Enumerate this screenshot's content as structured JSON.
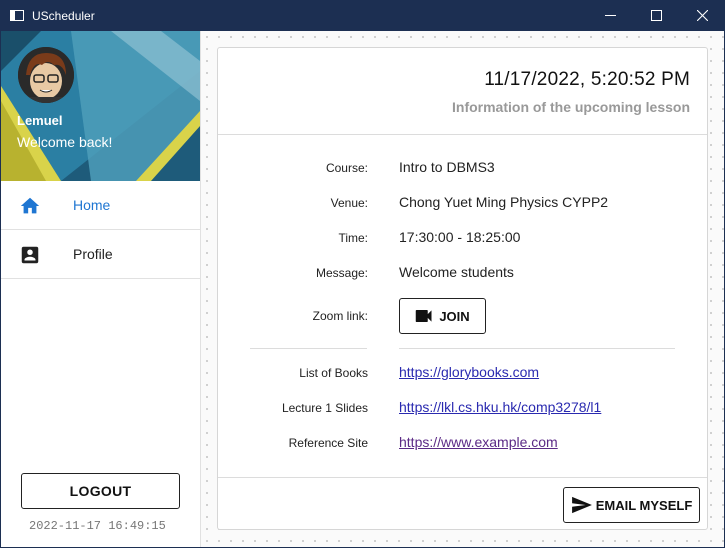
{
  "window": {
    "title": "UScheduler",
    "controls": [
      "minimize-icon",
      "maximize-icon",
      "close-icon"
    ]
  },
  "sidebar": {
    "user_name": "Lemuel",
    "welcome": "Welcome back!",
    "nav": [
      {
        "label": "Home",
        "icon": "home-icon",
        "active": true
      },
      {
        "label": "Profile",
        "icon": "profile-icon",
        "active": false
      }
    ],
    "logout_label": "LOGOUT",
    "timestamp": "2022-11-17 16:49:15"
  },
  "lesson": {
    "datetime": "11/17/2022, 5:20:52 PM",
    "subtitle": "Information of the upcoming lesson",
    "course_label": "Course:",
    "course": "Intro to DBMS3",
    "venue_label": "Venue:",
    "venue": "Chong Yuet Ming Physics CYPP2",
    "time_label": "Time:",
    "time": "17:30:00 - 18:25:00",
    "message_label": "Message:",
    "message": "Welcome students",
    "zoom_label": "Zoom link:",
    "join_label": "JOIN",
    "links": [
      {
        "label": "List of Books",
        "url": "https://glorybooks.com"
      },
      {
        "label": "Lecture 1 Slides",
        "url": "https://lkl.cs.hku.hk/comp3278/l1"
      },
      {
        "label": "Reference Site",
        "url": "https://www.example.com"
      }
    ],
    "email_label": "EMAIL MYSELF"
  },
  "colors": {
    "titlebar": "#1c2f52",
    "accent": "#1f76d2",
    "link": "#2a2ab0",
    "visited_link": "#5b2a86"
  }
}
